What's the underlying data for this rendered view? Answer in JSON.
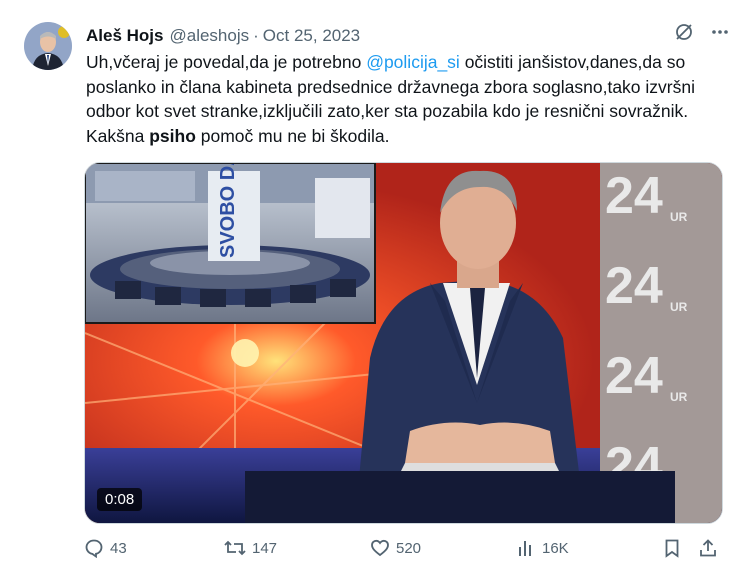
{
  "author": {
    "name": "Aleš Hojs",
    "handle": "@aleshojs",
    "separator": "·",
    "date": "Oct 25, 2023"
  },
  "tweet": {
    "part1": "Uh,včeraj je povedal,da je potrebno ",
    "mention": "@policija_si",
    "part2": " očistiti janšistov,danes,da so poslanko in člana kabineta predsednice državnega zbora soglasno,tako izvršni odbor kot svet stranke,izključili zato,ker sta pozabila kdo je resnični sovražnik. Kakšna ",
    "bold": "psiho",
    "part3": " pomoč mu ne bi škodila."
  },
  "media": {
    "duration": "0:08",
    "banner_text": "SVOBO DA!",
    "channel_text": "24",
    "channel_sub": "UR"
  },
  "actions": {
    "replies": "43",
    "reposts": "147",
    "likes": "520",
    "views": "16K"
  },
  "colors": {
    "accent": "#1d9bf0",
    "muted": "#536471",
    "text": "#0f1419"
  }
}
